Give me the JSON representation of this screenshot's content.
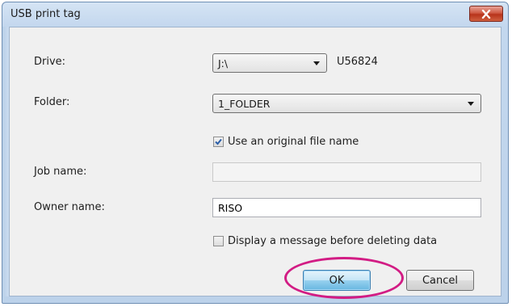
{
  "window": {
    "title": "USB print tag"
  },
  "form": {
    "drive_label": "Drive:",
    "drive_value": "J:\\",
    "drive_id": "U56824",
    "folder_label": "Folder:",
    "folder_value": "1_FOLDER",
    "use_original_name_label": "Use an original file name",
    "use_original_name_checked": true,
    "job_name_label": "Job name:",
    "job_name_value": "",
    "owner_name_label": "Owner name:",
    "owner_name_value": "RISO",
    "display_message_label": "Display a message before deleting data",
    "display_message_checked": false
  },
  "buttons": {
    "ok_label": "OK",
    "cancel_label": "Cancel"
  },
  "colors": {
    "highlight": "#d21c84",
    "close_button": "#c8452c",
    "window_frame": "#c3d7ee"
  },
  "icons": {
    "close": "close-icon",
    "dropdown": "chevron-down-icon",
    "check": "check-icon"
  }
}
